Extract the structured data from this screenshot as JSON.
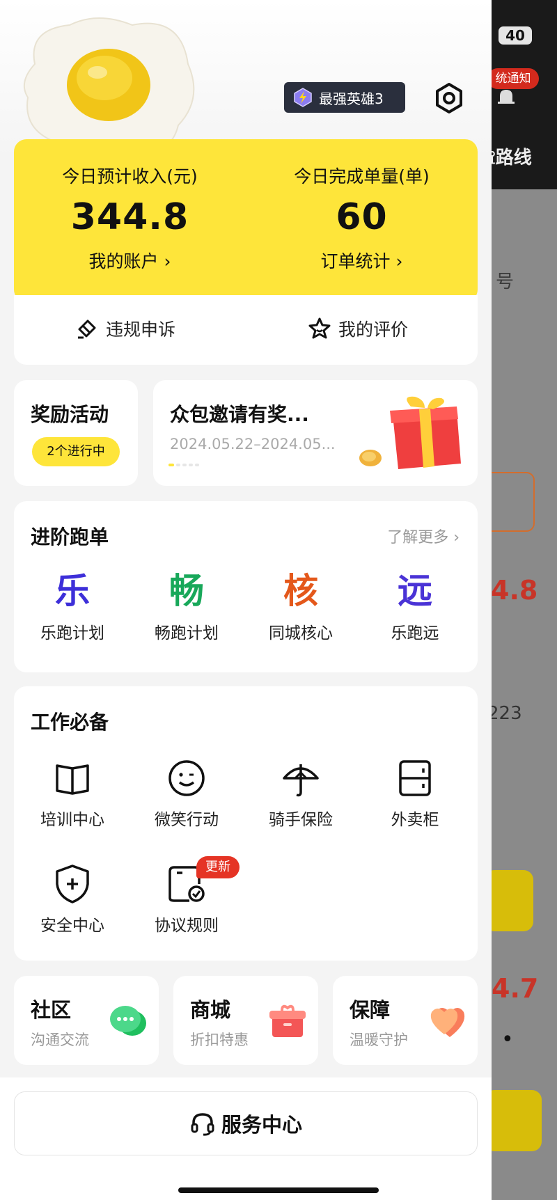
{
  "status_bar": {
    "battery": "40"
  },
  "background_app": {
    "notice_label": "统通知",
    "route_label": "路线",
    "order_suffix": "号",
    "value_1": "4.8",
    "value_2": "223",
    "value_3": "4.7"
  },
  "header": {
    "hero_label": "最强英雄3"
  },
  "stats": {
    "income_label": "今日预计收入(元)",
    "income_value": "344.8",
    "income_link": "我的账户 ›",
    "orders_label": "今日完成单量(单)",
    "orders_value": "60",
    "orders_link": "订单统计 ›",
    "appeal_label": "违规申诉",
    "review_label": "我的评价"
  },
  "rewards": {
    "title": "奖励活动",
    "status": "2个进行中",
    "invite_title": "众包邀请有奖...",
    "invite_date": "2024.05.22–2024.05..."
  },
  "advanced": {
    "title": "进阶跑单",
    "more": "了解更多 ›",
    "items": [
      {
        "glyph": "乐",
        "label": "乐跑计划",
        "color": "#3d2fd9"
      },
      {
        "glyph": "畅",
        "label": "畅跑计划",
        "color": "#18a85a"
      },
      {
        "glyph": "核",
        "label": "同城核心",
        "color": "#e4581b"
      },
      {
        "glyph": "远",
        "label": "乐跑远",
        "color": "#4a33d6"
      }
    ]
  },
  "work": {
    "title": "工作必备",
    "items": [
      {
        "icon": "book-icon",
        "label": "培训中心"
      },
      {
        "icon": "smile-icon",
        "label": "微笑行动"
      },
      {
        "icon": "umbrella-icon",
        "label": "骑手保险"
      },
      {
        "icon": "locker-icon",
        "label": "外卖柜"
      },
      {
        "icon": "shield-plus-icon",
        "label": "安全中心"
      },
      {
        "icon": "document-check-icon",
        "label": "协议规则"
      }
    ],
    "update_badge": "更新"
  },
  "shortcuts": [
    {
      "title": "社区",
      "subtitle": "沟通交流",
      "icon": "chat-icon"
    },
    {
      "title": "商城",
      "subtitle": "折扣特惠",
      "icon": "gift-box-icon"
    },
    {
      "title": "保障",
      "subtitle": "温暖守护",
      "icon": "heart-icon"
    }
  ],
  "service": {
    "label": "服务中心"
  },
  "colors": {
    "accent": "#fee53a",
    "alert": "#e53425"
  }
}
